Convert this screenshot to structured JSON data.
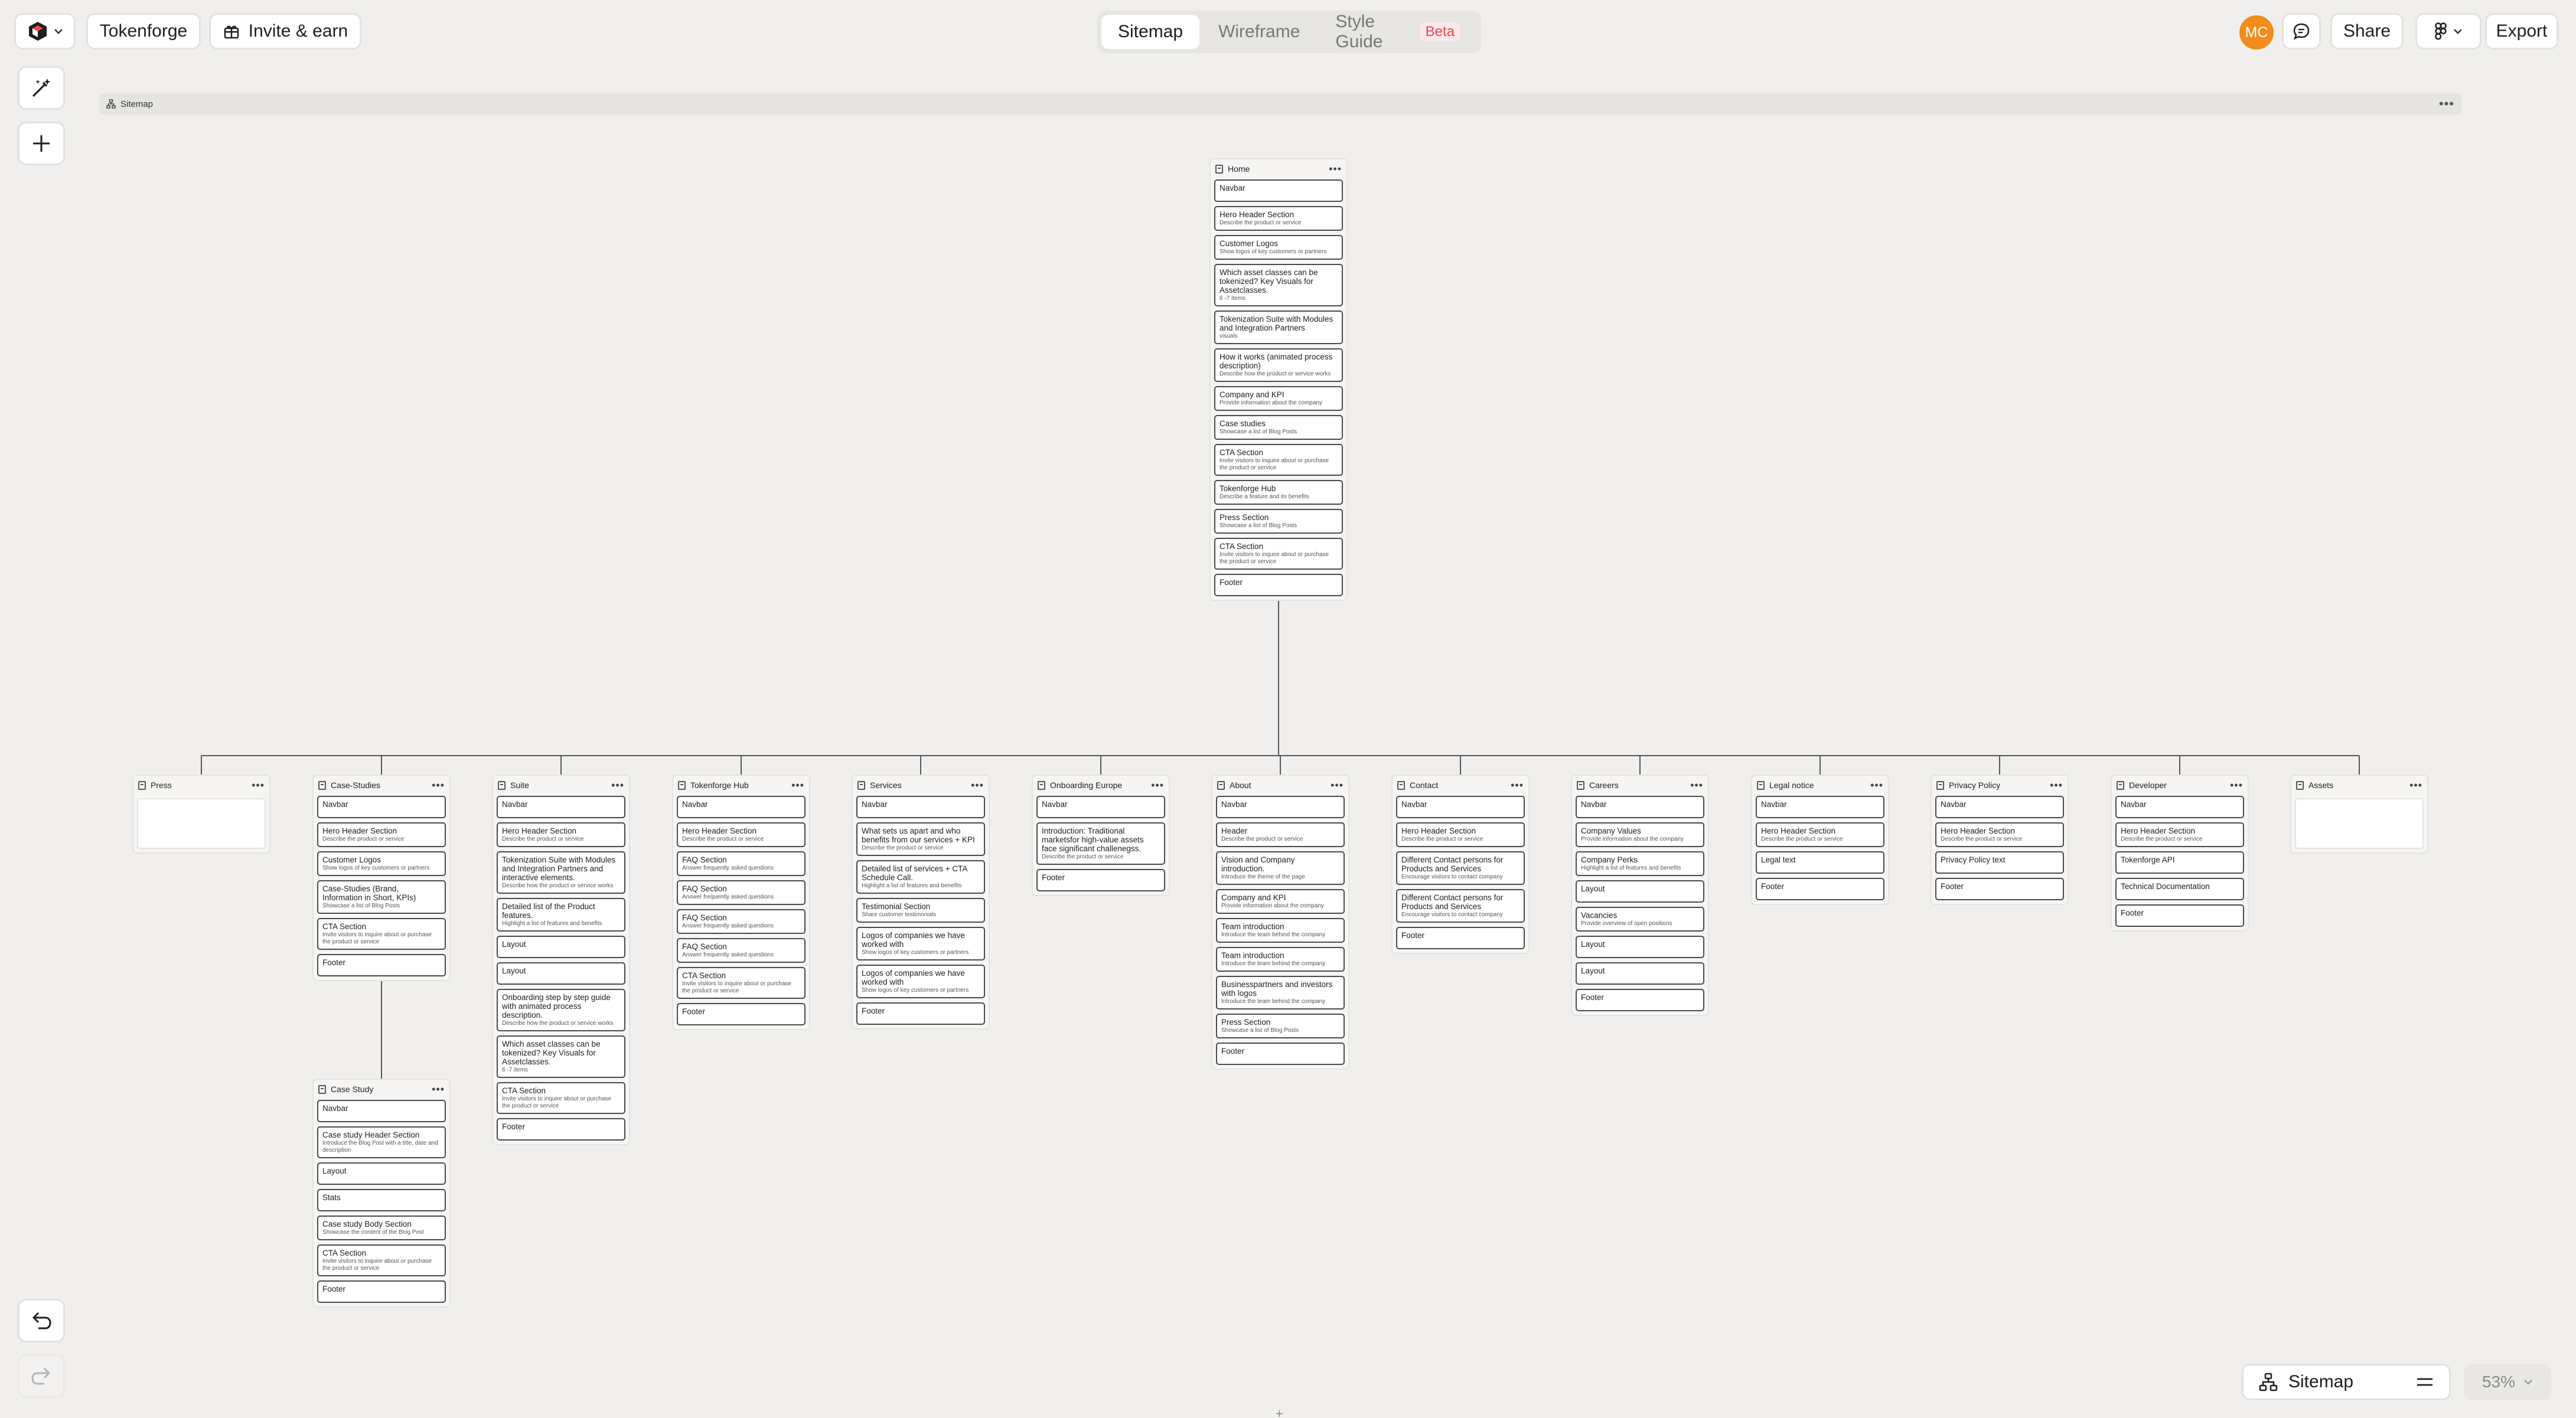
{
  "topbar": {
    "project_name": "Tokenforge",
    "invite_label": "Invite & earn",
    "tabs": [
      {
        "label": "Sitemap",
        "active": true
      },
      {
        "label": "Wireframe",
        "active": false
      },
      {
        "label": "Style Guide",
        "active": false,
        "badge": "Beta"
      }
    ],
    "avatar_initials": "MC",
    "share_label": "Share",
    "export_label": "Export",
    "accent_color": "#f28c1b"
  },
  "toolbar": {
    "icons": [
      "magic-wand-icon",
      "plus-icon"
    ],
    "undo_icon": "undo-icon",
    "redo_icon": "redo-icon"
  },
  "canvas": {
    "sitemap_label": "Sitemap",
    "home": {
      "title": "Home",
      "sections": [
        {
          "t": "Navbar",
          "d": ""
        },
        {
          "t": "Hero Header Section",
          "d": "Describe the product or service"
        },
        {
          "t": "Customer Logos",
          "d": "Show logos of key customers or partners"
        },
        {
          "t": "Which asset classes can be tokenized? Key Visuals for Assetclasses.",
          "d": "6 -7 items"
        },
        {
          "t": "Tokenization Suite with Modules and Integration Partners",
          "d": "visuals"
        },
        {
          "t": "How it works (animated process description)",
          "d": "Describe how the product or service works"
        },
        {
          "t": "Company and KPI",
          "d": "Provide information about the company"
        },
        {
          "t": "Case studies",
          "d": "Showcase a list of Blog Posts"
        },
        {
          "t": "CTA Section",
          "d": "Invite visitors to inquire about or purchase the product or service"
        },
        {
          "t": "Tokenforge Hub",
          "d": "Describe a feature and its benefits"
        },
        {
          "t": "Press Section",
          "d": "Showcase a list of Blog Posts"
        },
        {
          "t": "CTA Section",
          "d": "Invite visitors to inquire about or purchase the product or service"
        },
        {
          "t": "Footer",
          "d": ""
        }
      ]
    },
    "pages": [
      {
        "title": "Press",
        "sections": []
      },
      {
        "title": "Case-Studies",
        "sections": [
          {
            "t": "Navbar",
            "d": ""
          },
          {
            "t": "Hero Header Section",
            "d": "Describe the product or service"
          },
          {
            "t": "Customer Logos",
            "d": "Show logos of key customers or partners"
          },
          {
            "t": "Case-Studies (Brand, Information in Short, KPIs)",
            "d": "Showcase a list of Blog Posts"
          },
          {
            "t": "CTA Section",
            "d": "Invite visitors to inquire about or purchase the product or service"
          },
          {
            "t": "Footer",
            "d": ""
          }
        ]
      },
      {
        "title": "Suite",
        "sections": [
          {
            "t": "Navbar",
            "d": ""
          },
          {
            "t": "Hero Header Section",
            "d": "Describe the product or service"
          },
          {
            "t": "Tokenization Suite with Modules and Integration Partners and interactive elements.",
            "d": "Describe how the product or service works"
          },
          {
            "t": "Detailed list of the Product features.",
            "d": "Highlight a list of features and benefits"
          },
          {
            "t": "Layout",
            "d": ""
          },
          {
            "t": "Layout",
            "d": ""
          },
          {
            "t": "Onboarding step by step guide with animated process description.",
            "d": "Describe how the product or service works"
          },
          {
            "t": "Which asset classes can be tokenized? Key Visuals for Assetclasses.",
            "d": "6 -7 items"
          },
          {
            "t": "CTA Section",
            "d": "Invite visitors to inquire about or purchase the product or service"
          },
          {
            "t": "Footer",
            "d": ""
          }
        ]
      },
      {
        "title": "Tokenforge Hub",
        "sections": [
          {
            "t": "Navbar",
            "d": ""
          },
          {
            "t": "Hero Header Section",
            "d": "Describe the product or service"
          },
          {
            "t": "FAQ Section",
            "d": "Answer frequently asked questions"
          },
          {
            "t": "FAQ Section",
            "d": "Answer frequently asked questions"
          },
          {
            "t": "FAQ Section",
            "d": "Answer frequently asked questions"
          },
          {
            "t": "FAQ Section",
            "d": "Answer frequently asked questions"
          },
          {
            "t": "CTA Section",
            "d": "Invite visitors to inquire about or purchase the product or service"
          },
          {
            "t": "Footer",
            "d": ""
          }
        ]
      },
      {
        "title": "Services",
        "sections": [
          {
            "t": "Navbar",
            "d": ""
          },
          {
            "t": "What sets us apart and who benefits from our services + KPI",
            "d": "Describe the product or service"
          },
          {
            "t": "Detailed list of services + CTA Schedule Call.",
            "d": "Highlight a list of features and benefits"
          },
          {
            "t": "Testimonial Section",
            "d": "Share customer testimonials"
          },
          {
            "t": "Logos of companies we have worked with",
            "d": "Show logos of key customers or partners"
          },
          {
            "t": "Logos of companies we have worked with",
            "d": "Show logos of key customers or partners"
          },
          {
            "t": "Footer",
            "d": ""
          }
        ]
      },
      {
        "title": "Onboarding Europe",
        "sections": [
          {
            "t": "Navbar",
            "d": ""
          },
          {
            "t": "Introduction: Traditional marketsfor high-value assets face significant challenegss.",
            "d": "Describe the product or service"
          },
          {
            "t": "Footer",
            "d": ""
          }
        ]
      },
      {
        "title": "About",
        "sections": [
          {
            "t": "Navbar",
            "d": ""
          },
          {
            "t": "Header",
            "d": "Describe the product or service"
          },
          {
            "t": "Vision and Company introduction.",
            "d": "Introduce the theme of the page"
          },
          {
            "t": "Company and KPI",
            "d": "Provide information about the company"
          },
          {
            "t": "Team introduction",
            "d": "Introduce the team behind the company"
          },
          {
            "t": "Team introduction",
            "d": "Introduce the team behind the company"
          },
          {
            "t": "Businesspartners and investors with logos",
            "d": "Introduce the team behind the company"
          },
          {
            "t": "Press Section",
            "d": "Showcase a list of Blog Posts"
          },
          {
            "t": "Footer",
            "d": ""
          }
        ]
      },
      {
        "title": "Contact",
        "sections": [
          {
            "t": "Navbar",
            "d": ""
          },
          {
            "t": "Hero Header Section",
            "d": "Describe the product or service"
          },
          {
            "t": "Different Contact persons for Products and Services",
            "d": "Encourage visitors to contact company"
          },
          {
            "t": "Different Contact persons for Products and Services",
            "d": "Encourage visitors to contact company"
          },
          {
            "t": "Footer",
            "d": ""
          }
        ]
      },
      {
        "title": "Careers",
        "sections": [
          {
            "t": "Navbar",
            "d": ""
          },
          {
            "t": "Company Values",
            "d": "Provide information about the company"
          },
          {
            "t": "Company Perks",
            "d": "Highlight a list of features and benefits"
          },
          {
            "t": "Layout",
            "d": ""
          },
          {
            "t": "Vacancies",
            "d": "Provide overview of open positions"
          },
          {
            "t": "Layout",
            "d": ""
          },
          {
            "t": "Layout",
            "d": ""
          },
          {
            "t": "Footer",
            "d": ""
          }
        ]
      },
      {
        "title": "Legal notice",
        "sections": [
          {
            "t": "Navbar",
            "d": ""
          },
          {
            "t": "Hero Header Section",
            "d": "Describe the product or service"
          },
          {
            "t": "Legal text",
            "d": ""
          },
          {
            "t": "Footer",
            "d": ""
          }
        ]
      },
      {
        "title": "Privacy Policy",
        "sections": [
          {
            "t": "Navbar",
            "d": ""
          },
          {
            "t": "Hero Header Section",
            "d": "Describe the product or service"
          },
          {
            "t": "Privacy Policy text",
            "d": ""
          },
          {
            "t": "Footer",
            "d": ""
          }
        ]
      },
      {
        "title": "Developer",
        "sections": [
          {
            "t": "Navbar",
            "d": ""
          },
          {
            "t": "Hero Header Section",
            "d": "Describe the product or service"
          },
          {
            "t": "Tokenforge API",
            "d": ""
          },
          {
            "t": "Technical Documentation",
            "d": ""
          },
          {
            "t": "Footer",
            "d": ""
          }
        ]
      },
      {
        "title": "Assets",
        "sections": []
      }
    ],
    "case_study": {
      "title": "Case Study",
      "sections": [
        {
          "t": "Navbar",
          "d": ""
        },
        {
          "t": "Case study Header Section",
          "d": "Introduce the Blog Post with a title, date and description"
        },
        {
          "t": "Layout",
          "d": ""
        },
        {
          "t": "Stats",
          "d": ""
        },
        {
          "t": "Case study Body Section",
          "d": "Showcase the content of the Blog Post"
        },
        {
          "t": "CTA Section",
          "d": "Invite visitors to inquire about or purchase the product or service"
        },
        {
          "t": "Footer",
          "d": ""
        }
      ]
    }
  },
  "bottombar": {
    "view_label": "Sitemap",
    "zoom_label": "53%"
  }
}
